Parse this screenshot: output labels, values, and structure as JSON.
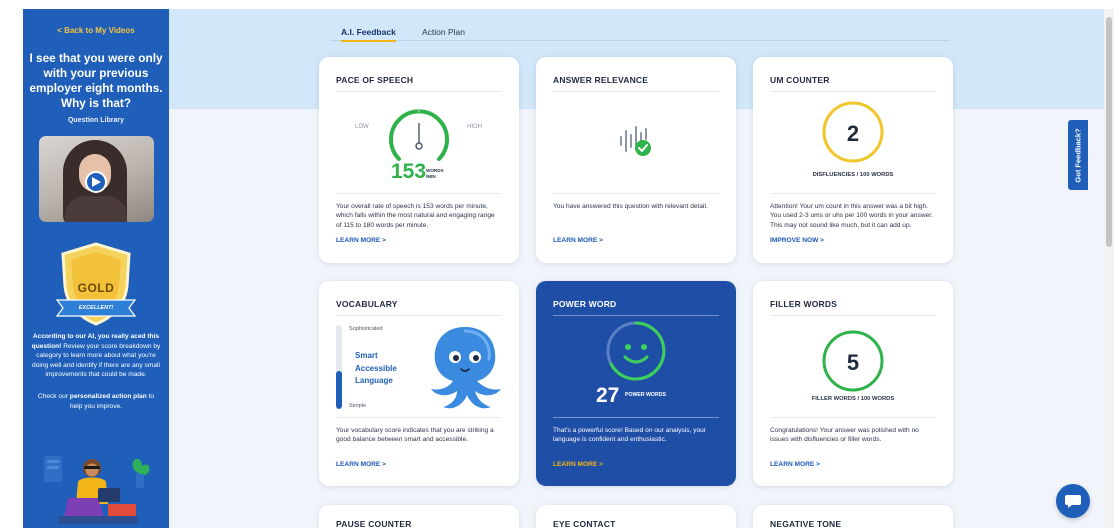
{
  "sidebar": {
    "back_link": "< Back to My Videos",
    "question": "I see that you were only with your previous employer eight months. Why is that?",
    "question_library": "Question Library",
    "badge_level": "GOLD",
    "badge_ribbon": "EXCELLENT!",
    "score_message_bold": "According to our AI, you really aced this question!",
    "score_message": "Review your score breakdown by category to learn more about what you're doing well and identify if there are any small improvements that could be made.",
    "plan_prefix": "Check our ",
    "plan_link": "personalized action plan",
    "plan_suffix": " to help you improve."
  },
  "tabs": [
    {
      "label": "A.I. Feedback",
      "active": true
    },
    {
      "label": "Action Plan",
      "active": false
    }
  ],
  "cards": {
    "pace": {
      "title": "PACE OF SPEECH",
      "low": "LOW",
      "high": "HIGH",
      "value": "153",
      "unit_line1": "WORDS",
      "unit_line2": "/MIN",
      "gauge_level": 0.5,
      "description": "Your overall rate of speech is 153 words per minute, which falls within the most natural and engaging range of 115 to 180 words per minute.",
      "link": "LEARN MORE >"
    },
    "relevance": {
      "title": "ANSWER RELEVANCE",
      "icon": "relevance-check-icon",
      "description": "You have answered this question with relevant detail.",
      "link": "LEARN MORE >"
    },
    "um": {
      "title": "UM COUNTER",
      "value": "2",
      "caption": "DISFLUENCIES / 100 WORDS",
      "description": "Attention! Your um count in this answer was a bit high. You used 2-3 ums or uhs per 100 words in your answer. This may not sound like much, but it can add up.",
      "link": "IMPROVE NOW >"
    },
    "vocabulary": {
      "title": "VOCABULARY",
      "top_label": "Sophisticated",
      "bottom_label": "Simple",
      "words": [
        "Smart",
        "Accessible",
        "Language"
      ],
      "level": 0.45,
      "description": "Your vocabulary score indicates that you are striking a good balance between smart and accessible.",
      "link": "LEARN MORE >"
    },
    "power": {
      "title": "POWER WORD",
      "value": "27",
      "unit": "POWER WORDS",
      "description": "That's a powerful score! Based on our analysis, your language is confident and enthusiastic.",
      "link": "LEARN MORE >"
    },
    "filler": {
      "title": "FILLER WORDS",
      "value": "5",
      "caption": "FILLER WORDS / 100 WORDS",
      "description": "Congratulations! Your answer was polished with no issues with disfluencies or filler words.",
      "link": "LEARN MORE >"
    },
    "pause": {
      "title": "PAUSE COUNTER"
    },
    "eye": {
      "title": "EYE CONTACT"
    },
    "negative": {
      "title": "NEGATIVE TONE"
    }
  },
  "feedback_tab": "Got Feedback?",
  "colors": {
    "brand_blue": "#1f5fb9",
    "gold": "#f2b417",
    "green": "#2db34a",
    "yellow_ring": "#efc52a"
  }
}
